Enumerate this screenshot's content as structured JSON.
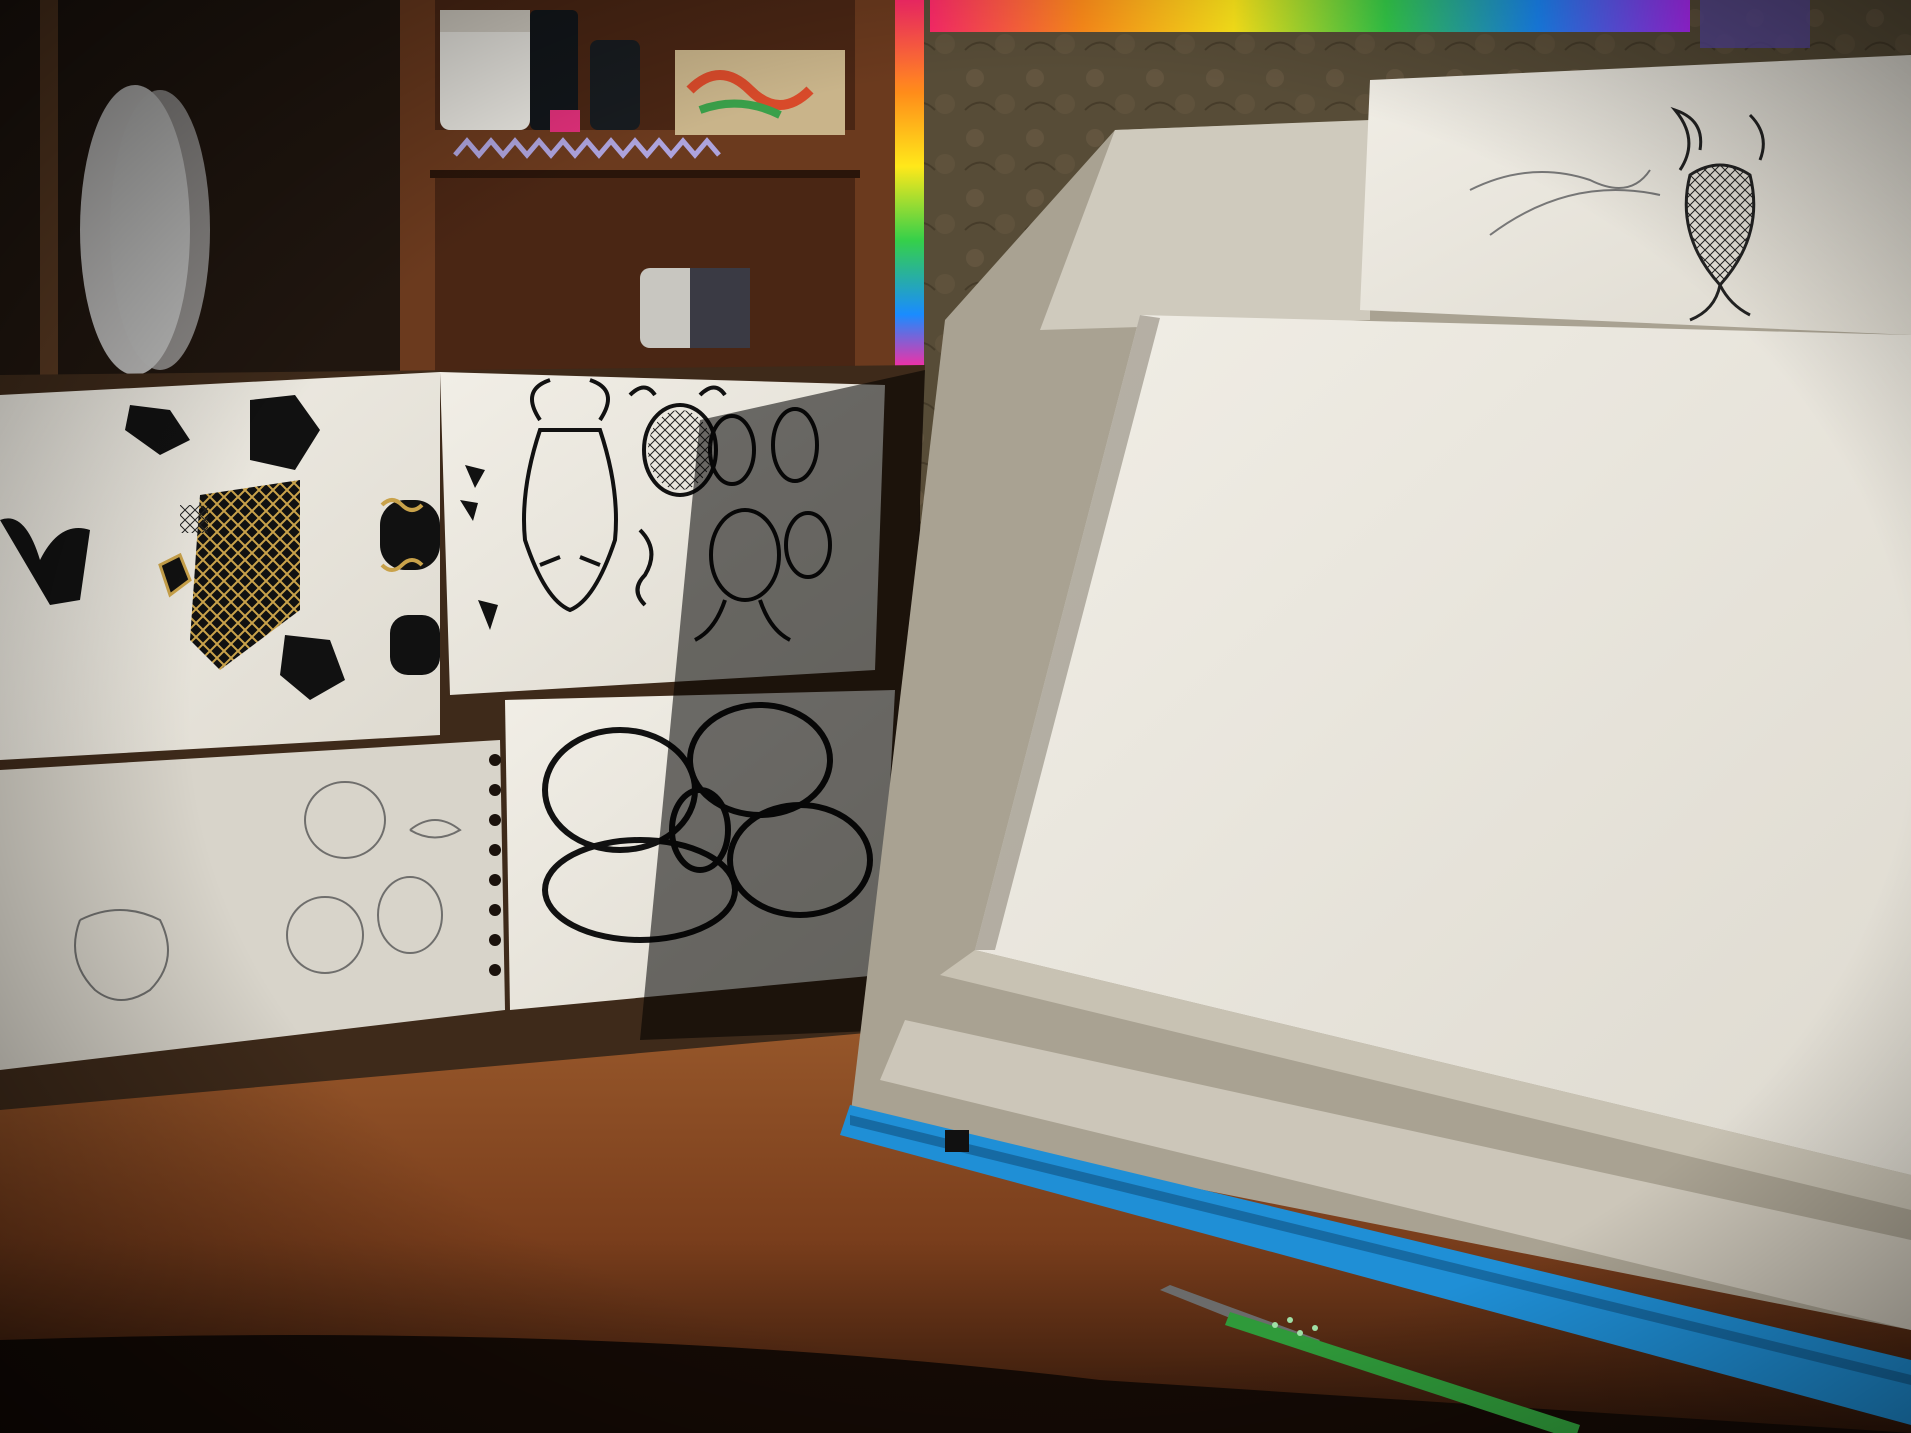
{
  "scene": {
    "description_visible_text": "",
    "colors": {
      "desk": "#8a4a22",
      "desk_dark": "#3a1e0e",
      "shelf": "#5c2f17",
      "wallpaper": "#7a6a4e",
      "paper": "#e9e6dd",
      "paper_shadow": "#b8b3a6",
      "ink": "#111111",
      "gold": "#c9a24a",
      "blue_cloth": "#1f8fd6",
      "pencil_green": "#2f9a3a"
    }
  }
}
